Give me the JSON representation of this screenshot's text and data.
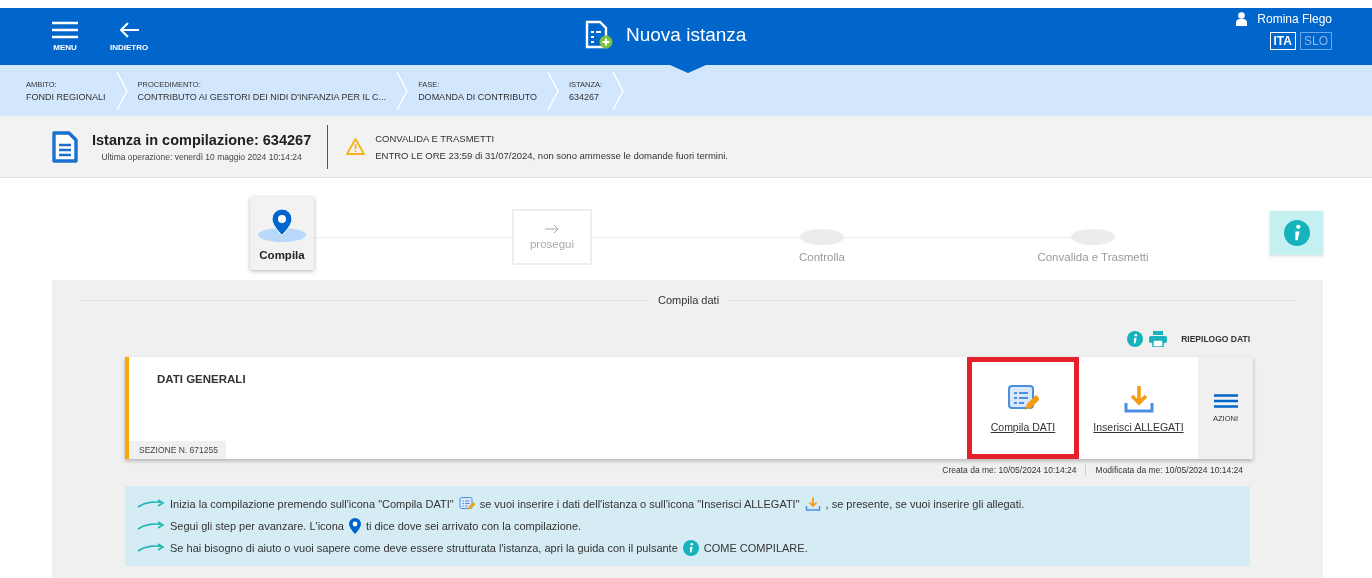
{
  "header": {
    "menu_label": "MENU",
    "back_label": "INDIETRO",
    "title": "Nuova istanza",
    "user": "Romina Flego",
    "languages": [
      {
        "label": "ITA",
        "selected": true
      },
      {
        "label": "SLO",
        "selected": false
      }
    ]
  },
  "breadcrumb": [
    {
      "caption": "AMBITO:",
      "value": "FONDI REGIONALI"
    },
    {
      "caption": "PROCEDIMENTO:",
      "value": "CONTRIBUTO AI GESTORI DEI NIDI D'INFANZIA PER IL C..."
    },
    {
      "caption": "FASE:",
      "value": "DOMANDA DI CONTRIBUTO"
    },
    {
      "caption": "ISTANZA:",
      "value": "634267"
    }
  ],
  "status": {
    "title": "Istanza in compilazione: 634267",
    "last_operation": "Ultima operazione: venerdì 10 maggio 2024 10:14:24",
    "notice_title": "CONVALIDA E TRASMETTI",
    "notice_text": "ENTRO LE ORE 23:59 di 31/07/2024, non sono ammesse le domande fuori termini."
  },
  "steps": [
    {
      "kind": "current",
      "label": "Compila"
    },
    {
      "kind": "next",
      "label": "prosegui"
    },
    {
      "kind": "pending",
      "label": "Controlla"
    },
    {
      "kind": "pending",
      "label": "Convalida e Trasmetti"
    }
  ],
  "panel": {
    "title": "Compila dati",
    "summary_label": "RIEPILOGO DATI",
    "section": {
      "title": "DATI GENERALI",
      "number": "SEZIONE N. 671255",
      "actions": [
        {
          "kind": "form",
          "label": "Compila DATI",
          "highlighted": true
        },
        {
          "kind": "download",
          "label": "Inserisci ALLEGATI",
          "highlighted": false
        }
      ],
      "menu_label": "AZIONI",
      "created": "Creata da me: 10/05/2024 10:14:24",
      "modified": "Modificata da me: 10/05/2024 10:14:24"
    },
    "tips": [
      [
        {
          "kind": "text",
          "text": "Inizia la compilazione premendo sull'icona \"Compila DATI\""
        },
        {
          "kind": "form"
        },
        {
          "kind": "text",
          "text": "se vuoi inserire i dati dell'istanza o sull'icona \"Inserisci ALLEGATI\""
        },
        {
          "kind": "download"
        },
        {
          "kind": "text",
          "text": ", se presente, se vuoi inserire gli allegati."
        }
      ],
      [
        {
          "kind": "text",
          "text": "Segui gli step per avanzare. L'icona"
        },
        {
          "kind": "pin"
        },
        {
          "kind": "text",
          "text": "ti dice dove sei arrivato con la compilazione."
        }
      ],
      [
        {
          "kind": "text",
          "text": "Se hai bisogno di aiuto o vuoi sapere come deve essere strutturata l'istanza, apri la guida con il pulsante"
        },
        {
          "kind": "info"
        },
        {
          "kind": "text",
          "text": "COME COMPILARE."
        }
      ]
    ]
  }
}
